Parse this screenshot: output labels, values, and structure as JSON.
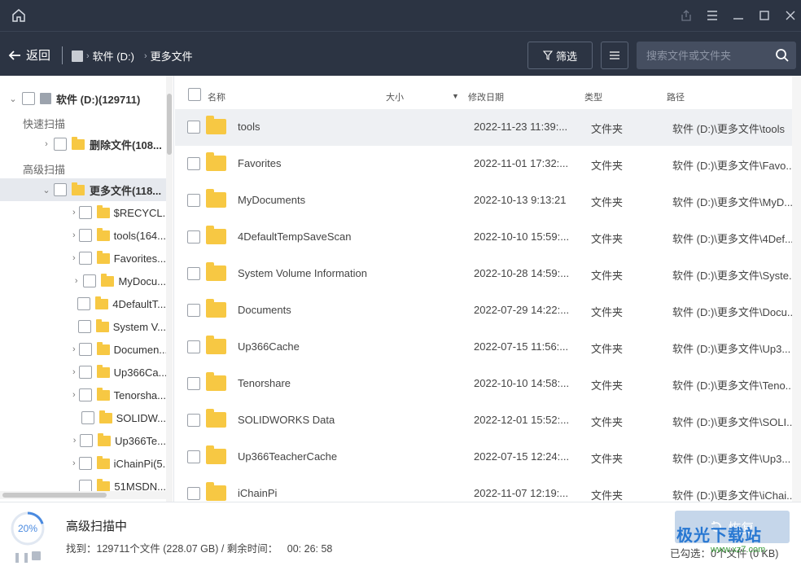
{
  "titlebar": {
    "icons": [
      "home-icon",
      "share-icon",
      "menu-icon",
      "minimize-icon",
      "maximize-icon",
      "close-icon"
    ]
  },
  "nav": {
    "back_label": "返回",
    "breadcrumb": [
      "软件 (D:)",
      "更多文件"
    ],
    "filter_label": "筛选",
    "search_placeholder": "搜索文件或文件夹"
  },
  "sidebar": {
    "root_label": "软件 (D:)(129711)",
    "quick_scan_label": "快速扫描",
    "deleted_label": "删除文件(108...",
    "advanced_scan_label": "高级扫描",
    "more_files_label": "更多文件(118...",
    "children": [
      "$RECYCL...",
      "tools(164...",
      "Favorites...",
      "MyDocu...",
      "4DefaultT...",
      "System V...",
      "Documen...",
      "Up366Ca...",
      "Tenorsha...",
      "SOLIDW...",
      "Up366Te...",
      "iChainPi(5...",
      "51MSDN..."
    ]
  },
  "table": {
    "headers": {
      "name": "名称",
      "size": "大小",
      "date": "修改日期",
      "type": "类型",
      "path": "路径"
    },
    "rows": [
      {
        "name": "tools",
        "date": "2022-11-23 11:39:...",
        "type": "文件夹",
        "path": "软件 (D:)\\更多文件\\tools"
      },
      {
        "name": "Favorites",
        "date": "2022-11-01 17:32:...",
        "type": "文件夹",
        "path": "软件 (D:)\\更多文件\\Favo..."
      },
      {
        "name": "MyDocuments",
        "date": "2022-10-13 9:13:21",
        "type": "文件夹",
        "path": "软件 (D:)\\更多文件\\MyD..."
      },
      {
        "name": "4DefaultTempSaveScan",
        "date": "2022-10-10 15:59:...",
        "type": "文件夹",
        "path": "软件 (D:)\\更多文件\\4Def..."
      },
      {
        "name": "System Volume Information",
        "date": "2022-10-28 14:59:...",
        "type": "文件夹",
        "path": "软件 (D:)\\更多文件\\Syste..."
      },
      {
        "name": "Documents",
        "date": "2022-07-29 14:22:...",
        "type": "文件夹",
        "path": "软件 (D:)\\更多文件\\Docu..."
      },
      {
        "name": "Up366Cache",
        "date": "2022-07-15 11:56:...",
        "type": "文件夹",
        "path": "软件 (D:)\\更多文件\\Up3..."
      },
      {
        "name": "Tenorshare",
        "date": "2022-10-10 14:58:...",
        "type": "文件夹",
        "path": "软件 (D:)\\更多文件\\Teno..."
      },
      {
        "name": "SOLIDWORKS Data",
        "date": "2022-12-01 15:52:...",
        "type": "文件夹",
        "path": "软件 (D:)\\更多文件\\SOLI..."
      },
      {
        "name": "Up366TeacherCache",
        "date": "2022-07-15 12:24:...",
        "type": "文件夹",
        "path": "软件 (D:)\\更多文件\\Up3..."
      },
      {
        "name": "iChainPi",
        "date": "2022-11-07 12:19:...",
        "type": "文件夹",
        "path": "软件 (D:)\\更多文件\\iChai..."
      }
    ]
  },
  "status": {
    "progress_text": "20%",
    "progress_value": 0.2,
    "scan_title": "高级扫描中",
    "found_label": "找到：",
    "found_value": "129711个文件 (228.07 GB) / 剩余时间：",
    "remaining": "00: 26: 58",
    "recover_label": "恢复",
    "selected_label": "已勾选：",
    "selected_value": "0个文件 (0 KB)"
  },
  "watermark": {
    "text": "极光下载站",
    "url": "www.xz7.com"
  },
  "colors": {
    "header_bg": "#2c3443",
    "accent": "#4a8ae0",
    "folder": "#f7c843",
    "recover_btn": "#c5d6ea"
  }
}
